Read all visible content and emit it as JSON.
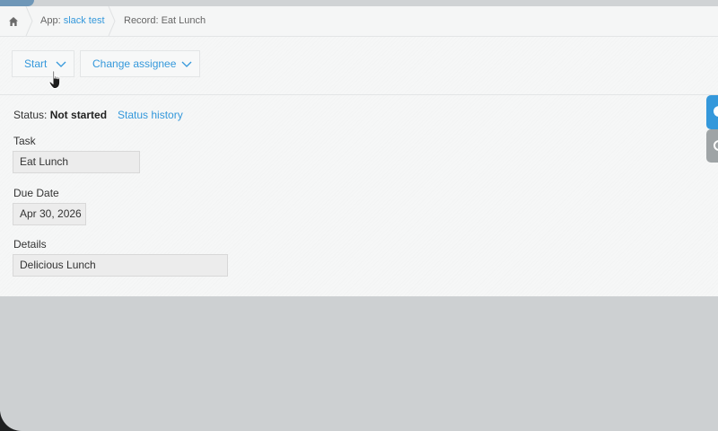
{
  "breadcrumb": {
    "app_prefix": "App: ",
    "app_name": "slack test",
    "record_prefix": "Record: ",
    "record_name": "Eat Lunch"
  },
  "toolbar": {
    "start_label": "Start",
    "change_assignee_label": "Change assignee"
  },
  "status": {
    "label": "Status: ",
    "value": "Not started",
    "history_link": "Status history"
  },
  "fields": [
    {
      "label": "Task",
      "value": "Eat Lunch"
    },
    {
      "label": "Due Date",
      "value": "Apr 30, 2026"
    },
    {
      "label": "Details",
      "value": "Delicious Lunch"
    }
  ],
  "icons": {
    "home": "home-icon",
    "chevron": "chevron-down-icon",
    "cursor": "hand-pointer-cursor-icon",
    "side_comment": "comment-icon",
    "side_history": "clock-icon"
  },
  "colors": {
    "link": "#3498db",
    "side_tab_active": "#3498db",
    "side_tab_inactive": "#9fa4a6"
  }
}
